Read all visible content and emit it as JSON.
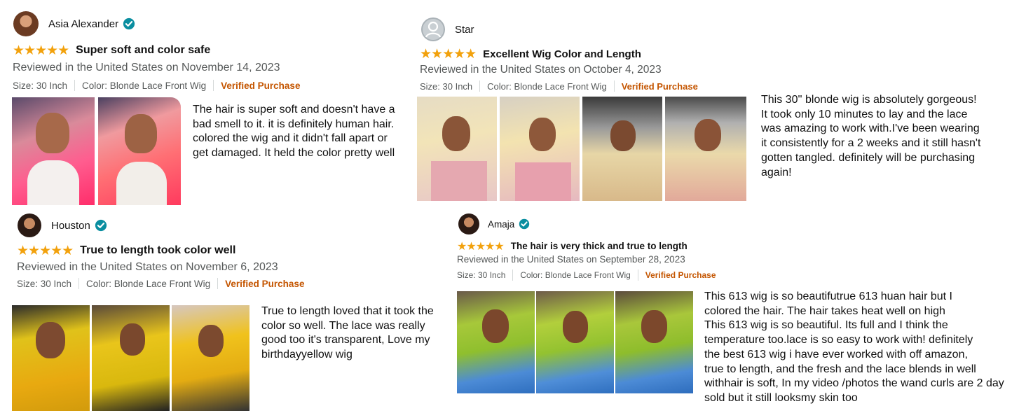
{
  "accent": {
    "star": "#f2a10c",
    "verified": "#c45500",
    "badge": "#0a8ea0",
    "meta_text": "#565959"
  },
  "reviews": [
    {
      "user": "Asia Alexander",
      "verified_badge": true,
      "rating": 5,
      "title": "Super soft and color safe",
      "reviewed": "Reviewed in the United States on November 14, 2023",
      "size": "Size: 30 Inch",
      "color": "Color: Blonde Lace Front Wig",
      "verified": "Verified Purchase",
      "body": "The hair is super soft and doesn't have a\nbad smell to it. it is definitely human hair.\n colored the wig and it didn't fall apart or\nget damaged. It held the color pretty well"
    },
    {
      "user": "Star",
      "verified_badge": false,
      "rating": 5,
      "title": "Excellent Wig Color and Length",
      "reviewed": "Reviewed in the United States on October 4, 2023",
      "size": "Size: 30 Inch",
      "color": "Color: Blonde Lace Front Wig",
      "verified": "Verified Purchase",
      "body": "This 30'' blonde wig is absolutely gorgeous!\nIt took only 10 minutes to lay and the lace\nwas amazing to work with.I've been wearing\nit consistently for a 2 weeks and it still hasn't\ngotten tangled.  definitely will be purchasing\nagain!"
    },
    {
      "user": "Houston",
      "verified_badge": true,
      "rating": 5,
      "title": "True to length took color well",
      "reviewed": "Reviewed in the United States on November 6, 2023",
      "size": "Size: 30 Inch",
      "color": "Color: Blonde Lace Front Wig",
      "verified": "Verified Purchase",
      "body": "True to length loved that it took the\ncolor so well. The lace was really\ngood too it's transparent, Love my\nbirthdayyellow wig"
    },
    {
      "user": "Amaja",
      "verified_badge": true,
      "rating": 5,
      "title": "The hair is very thick and true to length",
      "reviewed": "Reviewed in the United States on September 28, 2023",
      "size": "Size: 30 Inch",
      "color": "Color: Blonde Lace Front Wig",
      "verified": "Verified Purchase",
      "body": "This 613 wig is so beautifutrue 613 huan hair but I\ncolored the hair. The hair takes heat well on high\nThis 613 wig is so beautiful. Its full and I think the\ntemperature too.lace is so easy to work with! definitely\nthe best 613 wig i have ever worked with off amazon,\ntrue to length, and the fresh and the lace blends in well\nwithhair is soft, In my video /photos the wand curls are 2 day\nsold but it still looksmy skin too"
    }
  ],
  "stars_glyph": "★★★★★",
  "icons": {
    "badge": "verified-check-icon",
    "avatar_default": "user-silhouette-icon"
  }
}
